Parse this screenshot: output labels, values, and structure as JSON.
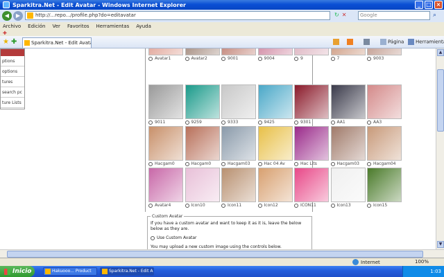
{
  "window": {
    "title": "Sparkitra.Net - Edit Avatar - Windows Internet Explorer",
    "min": "_",
    "max": "□",
    "close": "×"
  },
  "address": {
    "url": "http://...repo.../profile.php?do=editavatar",
    "search_placeholder": "Google"
  },
  "menu": [
    "Archivo",
    "Edición",
    "Ver",
    "Favoritos",
    "Herramientas",
    "Ayuda"
  ],
  "tab": {
    "label": "Sparkitra.Net - Edit Avatar"
  },
  "commands": {
    "page": "Página",
    "tools": "Herramientas"
  },
  "sidebar": {
    "items": [
      "ptions",
      "options",
      "tures",
      "search pc",
      "ture Lists"
    ]
  },
  "avatars": [
    {
      "caption": "Avatar1",
      "color": "#d88a7a"
    },
    {
      "caption": "Avatar2",
      "color": "#8a6a5a"
    },
    {
      "caption": "9001",
      "color": "#b06050"
    },
    {
      "caption": "9004",
      "color": "#c46a8a"
    },
    {
      "caption": "9",
      "color": "#d4a0b0"
    },
    {
      "caption": "7",
      "color": "#c08060"
    },
    {
      "caption": "9003",
      "color": "#b08070"
    },
    {
      "caption": "9011",
      "color": "#9a9a9a"
    },
    {
      "caption": "9259",
      "color": "#1a9a8a"
    },
    {
      "caption": "9333",
      "color": "#c8c8c8"
    },
    {
      "caption": "9425",
      "color": "#4aa8c8"
    },
    {
      "caption": "9301",
      "color": "#8a1a2a"
    },
    {
      "caption": "AA1",
      "color": "#3a3a4a"
    },
    {
      "caption": "AA3",
      "color": "#d48a8a"
    },
    {
      "caption": "Hacgam0",
      "color": "#c8906a"
    },
    {
      "caption": "Hacgam0",
      "color": "#b8705a"
    },
    {
      "caption": "Hacgam03",
      "color": "#8a9aaa"
    },
    {
      "caption": "Hac 04 Av",
      "color": "#e8c048"
    },
    {
      "caption": "Hac Lits",
      "color": "#9a2a8a"
    },
    {
      "caption": "Hacgam03",
      "color": "#a07a6a"
    },
    {
      "caption": "Hacgam04",
      "color": "#c89a7a"
    },
    {
      "caption": "Avatar4",
      "color": "#c868a8"
    },
    {
      "caption": "Icon10",
      "color": "#e8c0d8"
    },
    {
      "caption": "Icon11",
      "color": "#b89070"
    },
    {
      "caption": "Icon12",
      "color": "#d8a070"
    },
    {
      "caption": "ICON11",
      "color": "#e84888"
    },
    {
      "caption": "Icon13",
      "color": "#f0f0f0"
    },
    {
      "caption": "Icon15",
      "color": "#4a7a2a"
    }
  ],
  "custom": {
    "legend": "Custom Avatar",
    "desc": "If you have a custom avatar and want to keep it as it is, leave the below below as they are.",
    "use_label": "Use Custom Avatar",
    "upload": "You may upload a new custom image using the controls below."
  },
  "status": {
    "zone": "Internet",
    "zoom": "100%"
  },
  "taskbar": {
    "start": "Inicio",
    "tasks": [
      "Hakuooo... Product",
      "Sparkitra.Net - Edit A"
    ],
    "clock": "1:03"
  }
}
